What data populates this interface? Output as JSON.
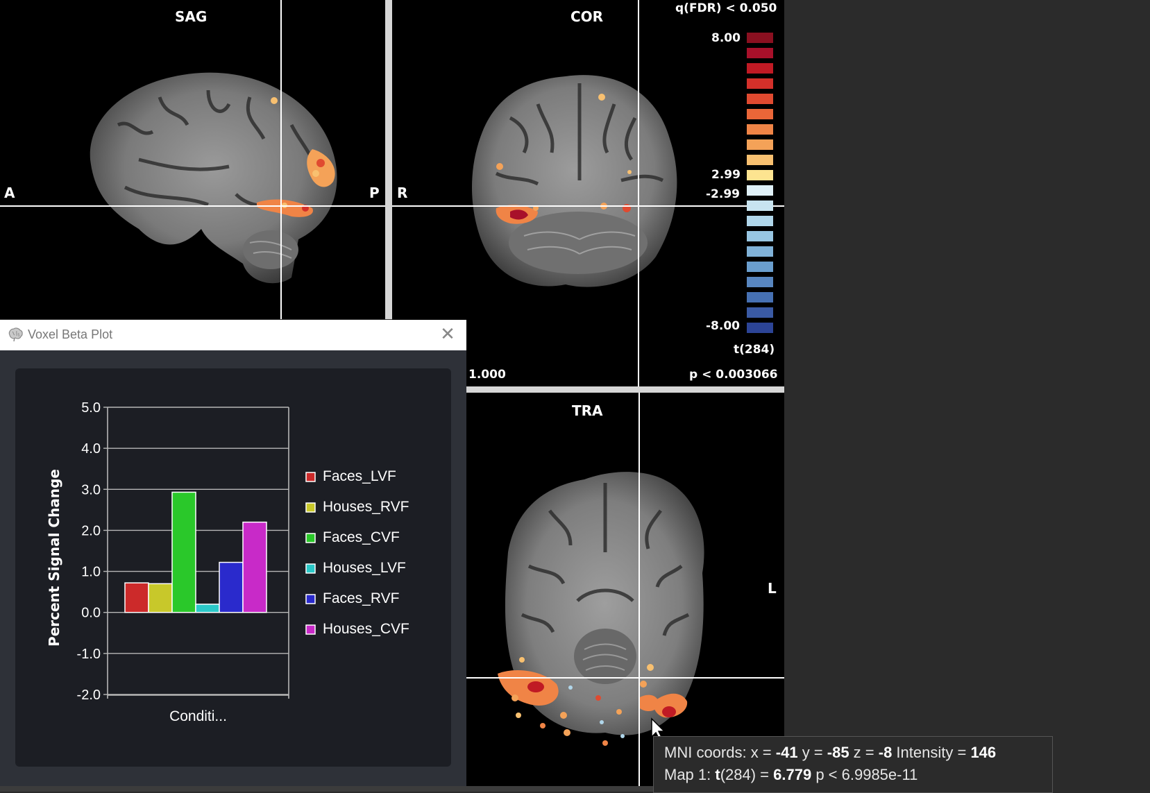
{
  "views": {
    "sag": {
      "label": "SAG",
      "left": "A",
      "right": "P"
    },
    "cor": {
      "label": "COR",
      "left": "R"
    },
    "tra": {
      "label": "TRA",
      "right": "L"
    }
  },
  "colorbar": {
    "title": "q(FDR) < 0.050",
    "max": "8.00",
    "pos_thresh": "2.99",
    "neg_thresh": "-2.99",
    "min": "-8.00",
    "stat": "t(284)",
    "pval": "p < 0.003066",
    "opacity": "1.000",
    "pos_colors": [
      "#8a1020",
      "#a8102a",
      "#c01a24",
      "#d4302a",
      "#e04a30",
      "#ea6638",
      "#f08446",
      "#f4a258",
      "#f8c070",
      "#fde490"
    ],
    "neg_colors": [
      "#dff0f7",
      "#c8e4f0",
      "#b0d6ea",
      "#98c6e2",
      "#80b2d8",
      "#6a9ece",
      "#5886c0",
      "#4670b2",
      "#3a5aa4",
      "#2c4496"
    ]
  },
  "plot_window": {
    "title": "Voxel Beta Plot",
    "close_icon": "close-icon",
    "brain_icon": "brain-icon"
  },
  "chart_data": {
    "type": "bar",
    "categories": [
      "Conditi..."
    ],
    "series": [
      {
        "name": "Faces_LVF",
        "value": 0.72,
        "color": "#cc2a2a"
      },
      {
        "name": "Houses_RVF",
        "value": 0.7,
        "color": "#c8c82a"
      },
      {
        "name": "Faces_CVF",
        "value": 2.93,
        "color": "#2ac82a"
      },
      {
        "name": "Houses_LVF",
        "value": 0.2,
        "color": "#2ac8c8"
      },
      {
        "name": "Faces_RVF",
        "value": 1.22,
        "color": "#2a2acc"
      },
      {
        "name": "Houses_CVF",
        "value": 2.2,
        "color": "#c82ac8"
      }
    ],
    "ylabel": "Percent Signal Change",
    "xlabel": "",
    "ylim": [
      -2.0,
      5.0
    ],
    "yticks": [
      "5.0",
      "4.0",
      "3.0",
      "2.0",
      "1.0",
      "0.0",
      "-1.0",
      "-2.0"
    ],
    "grid": true,
    "legend": "right"
  },
  "tooltip": {
    "coords_prefix": "MNI coords: x = ",
    "x": "-41",
    "y_prefix": " y = ",
    "y": "-85",
    "z_prefix": " z = ",
    "z": "-8",
    "intensity_prefix": "  Intensity = ",
    "intensity": "146",
    "map_prefix": "Map 1: ",
    "stat_name": "t",
    "stat_df": "(284) = ",
    "stat_value": "6.779",
    "p_text": "  p < 6.9985e-11"
  }
}
